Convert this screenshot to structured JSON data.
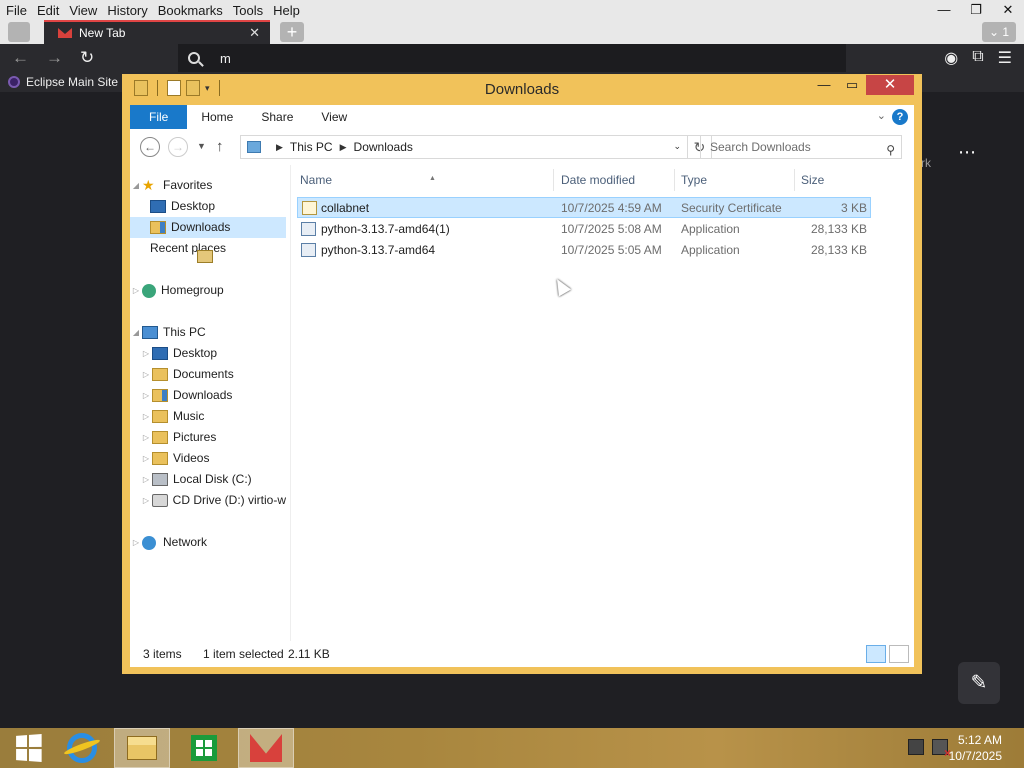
{
  "browser": {
    "menu": [
      "File",
      "Edit",
      "View",
      "History",
      "Bookmarks",
      "Tools",
      "Help"
    ],
    "tab_title": "New Tab",
    "tab_count": "1",
    "address_value": "m",
    "bookmark_label": "Eclipse Main Site",
    "content_fragment": "rk"
  },
  "explorer": {
    "title": "Downloads",
    "ribbon_tabs": [
      "File",
      "Home",
      "Share",
      "View"
    ],
    "breadcrumb": [
      "This PC",
      "Downloads"
    ],
    "search_placeholder": "Search Downloads",
    "nav": {
      "favorites": "Favorites",
      "fav_items": [
        "Desktop",
        "Downloads",
        "Recent places"
      ],
      "homegroup": "Homegroup",
      "thispc": "This PC",
      "pc_items": [
        "Desktop",
        "Documents",
        "Downloads",
        "Music",
        "Pictures",
        "Videos",
        "Local Disk (C:)",
        "CD Drive (D:) virtio-w"
      ],
      "network": "Network"
    },
    "columns": [
      "Name",
      "Date modified",
      "Type",
      "Size"
    ],
    "files": [
      {
        "name": "collabnet",
        "date": "10/7/2025 4:59 AM",
        "type": "Security Certificate",
        "size": "3 KB",
        "selected": true
      },
      {
        "name": "python-3.13.7-amd64(1)",
        "date": "10/7/2025 5:08 AM",
        "type": "Application",
        "size": "28,133 KB",
        "selected": false
      },
      {
        "name": "python-3.13.7-amd64",
        "date": "10/7/2025 5:05 AM",
        "type": "Application",
        "size": "28,133 KB",
        "selected": false
      }
    ],
    "status": {
      "count": "3 items",
      "selection": "1 item selected",
      "size": "2.11 KB"
    }
  },
  "taskbar": {
    "time": "5:12 AM",
    "date": "10/7/2025"
  }
}
